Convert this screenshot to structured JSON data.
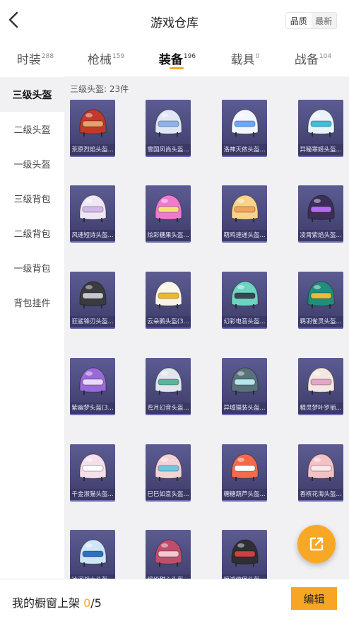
{
  "header": {
    "title": "游戏仓库",
    "sort_options": [
      "品质",
      "最新"
    ],
    "active_sort": "品质"
  },
  "tabs": [
    {
      "label": "时装",
      "count": "288"
    },
    {
      "label": "枪械",
      "count": "159"
    },
    {
      "label": "装备",
      "count": "196",
      "active": true
    },
    {
      "label": "载具",
      "count": "0"
    },
    {
      "label": "战备",
      "count": "104"
    }
  ],
  "sidebar": {
    "items": [
      {
        "label": "三级头盔",
        "active": true
      },
      {
        "label": "二级头盔"
      },
      {
        "label": "一级头盔"
      },
      {
        "label": "三级背包"
      },
      {
        "label": "二级背包"
      },
      {
        "label": "一级背包"
      },
      {
        "label": "背包挂件"
      }
    ]
  },
  "content": {
    "section_label": "三级头盔: 23件",
    "items": [
      {
        "name": "荒原烈焰头盔...",
        "color": "#c0392b",
        "accent": "#e8a06a"
      },
      {
        "name": "雪国风尚头盔...",
        "color": "#dfe7f5",
        "accent": "#8fb3e8"
      },
      {
        "name": "洛神天依头盔...",
        "color": "#f2f6ff",
        "accent": "#6aa7ff"
      },
      {
        "name": "异瞳寒姬头盔...",
        "color": "#e9f4f8",
        "accent": "#3bc1d8"
      },
      {
        "name": "风速短诗头盔...",
        "color": "#efe7f5",
        "accent": "#d3b7e8"
      },
      {
        "name": "炫彩糖果头盔...",
        "color": "#f07ad0",
        "accent": "#fbe07a"
      },
      {
        "name": "萌鸡速递头盔...",
        "color": "#f7d48a",
        "accent": "#f2a35c"
      },
      {
        "name": "凌霄紫焰头盔...",
        "color": "#3b2f5a",
        "accent": "#b26cf2"
      },
      {
        "name": "狂鲨锋刃头盔...",
        "color": "#3a3a3f",
        "accent": "#c7c7cf"
      },
      {
        "name": "云朵鹅头盔(3...",
        "color": "#fbf5e6",
        "accent": "#f2b62c"
      },
      {
        "name": "幻彩电音头盔...",
        "color": "#6fd3c2",
        "accent": "#3d4552"
      },
      {
        "name": "羁羽雀灵头盔...",
        "color": "#1f8f7a",
        "accent": "#f0b93a"
      },
      {
        "name": "紫幽梦头盔(3...",
        "color": "#9a6ad8",
        "accent": "#e7d9ff"
      },
      {
        "name": "弯月幻音头盔...",
        "color": "#dfe6ee",
        "accent": "#5ab39b"
      },
      {
        "name": "异域猫装头盔...",
        "color": "#5a7279",
        "accent": "#b6e7ea"
      },
      {
        "name": "精灵梦叶罗丽...",
        "color": "#f4e7e1",
        "accent": "#e5a5c5"
      },
      {
        "name": "千金淑猫头盔...",
        "color": "#f6dfea",
        "accent": "#ffffff"
      },
      {
        "name": "巳巳如意头盔...",
        "color": "#f3d3d6",
        "accent": "#6fc7e1"
      },
      {
        "name": "糖糖葫芦头盔...",
        "color": "#f46a4b",
        "accent": "#ffffff"
      },
      {
        "name": "香槟花海头盔...",
        "color": "#f4c2c5",
        "accent": "#fbe8e8"
      },
      {
        "name": "冰河战士头盔...",
        "color": "#cfe6f7",
        "accent": "#2b6fc7"
      },
      {
        "name": "缤纷甜心头盔...",
        "color": "#c04d6a",
        "accent": "#f2c6d2"
      },
      {
        "name": "惊鸿侠侣头盔...",
        "color": "#2f2f33",
        "accent": "#d04040"
      }
    ]
  },
  "fab": {
    "icon": "share-icon"
  },
  "bottom": {
    "shelf_label": "我的橱窗上架 ",
    "shelf_current": "0",
    "shelf_sep": "/",
    "shelf_total": "5",
    "edit_label": "编辑"
  },
  "colors": {
    "accent": "#f6a623",
    "card_bg": "#4b4a78"
  }
}
